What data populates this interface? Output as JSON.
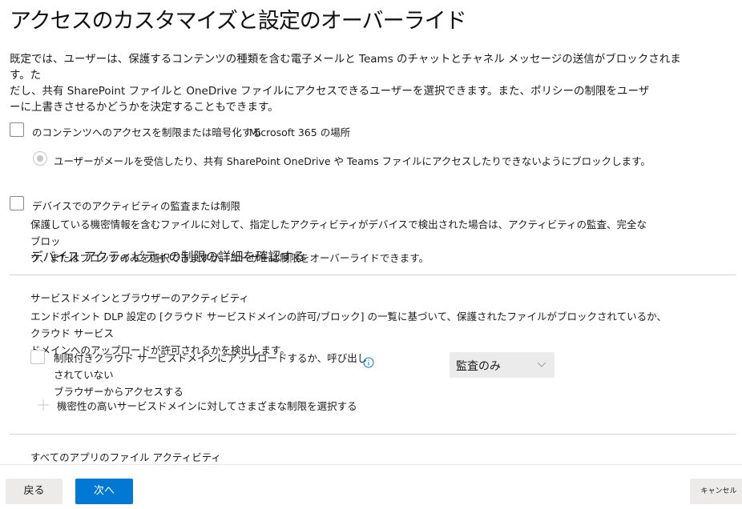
{
  "page": {
    "title": "アクセスのカスタマイズと設定のオーバーライド",
    "intro_lines": [
      "既定では、ユーザーは、保護するコンテンツの種類を含む電子メールと Teams のチャットとチャネル メッセージの送信がブロックされます。た",
      "だし、共有 SharePoint ファイルと OneDrive ファイルにアクセスできるユーザーを選択できます。また、ポリシーの制限をユーザ",
      "ーに上書きさせるかどうかを決定することもできます。"
    ]
  },
  "m365_section": {
    "checkbox_label": "のコンテンツへのアクセスを制限または暗号化する",
    "location_label": "Microsoft 365 の場所",
    "checked": false,
    "radio_label": "ユーザーがメールを受信したり、共有 SharePoint OneDrive や Teams ファイルにアクセスしたりできないようにブロックします。",
    "radio_selected": true,
    "radio_disabled": true
  },
  "device_section": {
    "checkbox_label": "デバイスでのアクティビティの監査または制限",
    "checked": false,
    "description_lines": [
      "保護している機密情報を含むファイルに対して、指定したアクティビティがデバイスで検出された場合は、アクティビティの監査、完全なブロッ",
      "ク、またはブロックのみを選択できますが、ユーザーは制限をオーバーライドできます。"
    ],
    "learn_more_link": "デバイス アクティビティの制限の詳細を確認する"
  },
  "service_domain_section": {
    "heading": "サービスドメインとブラウザーのアクティビティ",
    "description_lines": [
      "エンドポイント DLP 設定の [クラウド サービスドメインの許可/ブロック] の一覧に基づいて、保護されたファイルがブロックされているか、クラウド サービス",
      "ドメインへのアップロードが許可されるかを検出します。"
    ],
    "option": {
      "label_lines": [
        "制限付きクラウド サービスドメインにアップロードするか、呼び出しされていない",
        "ブラウザーからアクセスする"
      ],
      "checked": false,
      "info_icon": "info-icon",
      "dropdown_value": "監査のみ"
    },
    "add_link": "機密性の高いサービスドメインに対してさまざまな制限を選択する"
  },
  "all_apps_section": {
    "heading": "すべてのアプリのファイル アクティビティ"
  },
  "footer": {
    "back_label": "戻る",
    "next_label": "次へ",
    "cancel_label": "キャンセル",
    "primary_color": "#0078d4"
  }
}
